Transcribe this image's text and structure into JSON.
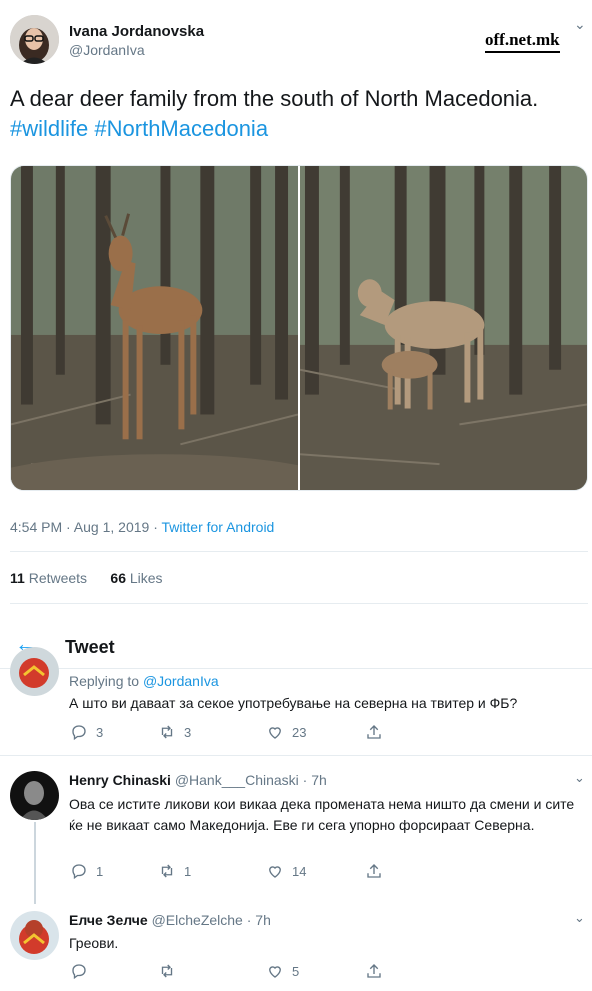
{
  "tweet": {
    "author_name": "Ivana Jordanovska",
    "author_handle": "@JordanIva",
    "watermark": "off.net.mk",
    "text": "A dear deer family from the south of North Macedonia.",
    "hashtags": [
      "#wildlife",
      "#NorthMacedonia"
    ],
    "timestamp": "4:54 PM · Aug 1, 2019 · ",
    "source": "Twitter for Android",
    "retweets_count": "11",
    "retweets_label": "Retweets",
    "likes_count": "66",
    "likes_label": "Likes"
  },
  "topbar": {
    "back_icon": "back-arrow-icon",
    "title": "Tweet"
  },
  "replies": [
    {
      "replying_prefix": "Replying to ",
      "replying_to": "@JordanIva",
      "text": "А што ви даваат за секое употребување на северна на твитер и ФБ?",
      "reply_count": "3",
      "retweet_count": "3",
      "like_count": "23"
    },
    {
      "name": "Henry Chinaski",
      "handle": "@Hank___Chinaski · 7h",
      "text": "Ова се истите ликови кои викаа дека промената нема ништо да смени и сите ќе не викаат само Македонија. Еве ги сега упорно форсираат Северна.",
      "reply_count": "1",
      "retweet_count": "1",
      "like_count": "14"
    },
    {
      "name": "Елче Зелче",
      "handle": "@ElcheZelche · 7h",
      "text": "Греови.",
      "reply_count": "",
      "retweet_count": "",
      "like_count": "5"
    }
  ],
  "colors": {
    "link": "#1b95e0",
    "secondary": "#657786",
    "text": "#14171a",
    "divider": "#e6ecf0"
  }
}
